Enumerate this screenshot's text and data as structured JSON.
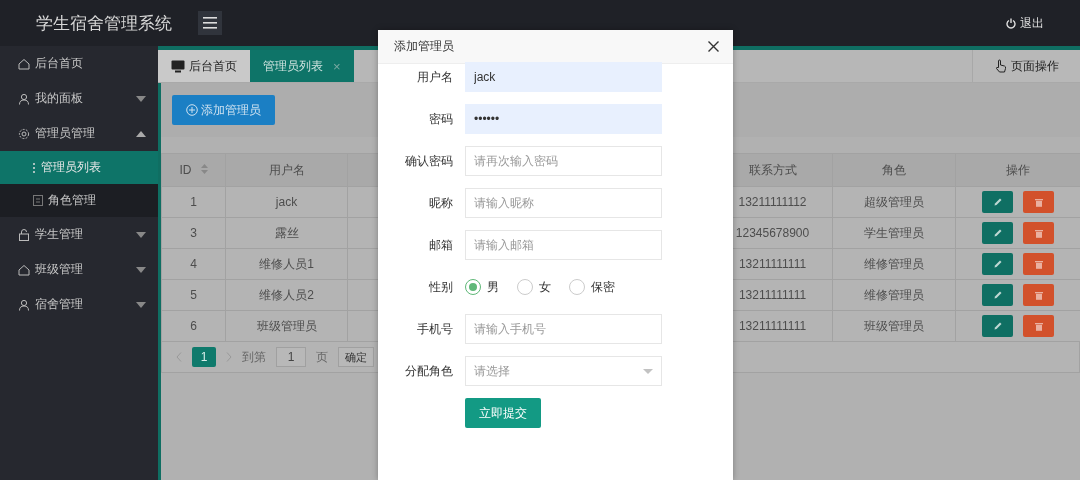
{
  "header": {
    "title": "学生宿舍管理系统",
    "logout": "退出"
  },
  "sidebar": {
    "items": [
      {
        "kind": "link",
        "label": "后台首页",
        "selected": false
      },
      {
        "kind": "group",
        "label": "我的面板",
        "selected": false,
        "expanded": false
      },
      {
        "kind": "group",
        "label": "管理员管理",
        "selected": false,
        "expanded": true,
        "children": [
          {
            "label": "管理员列表",
            "selected": true
          },
          {
            "label": "角色管理",
            "selected": false
          }
        ]
      },
      {
        "kind": "group",
        "label": "学生管理",
        "selected": false,
        "expanded": false
      },
      {
        "kind": "group",
        "label": "班级管理",
        "selected": false,
        "expanded": false
      },
      {
        "kind": "group",
        "label": "宿舍管理",
        "selected": false,
        "expanded": false
      }
    ]
  },
  "tabs": [
    {
      "kind": "home",
      "label": "后台首页",
      "selected": false
    },
    {
      "kind": "page",
      "label": "管理员列表",
      "selected": true,
      "close": "×"
    }
  ],
  "page_actions": "页面操作",
  "add_button": "添加管理员",
  "table": {
    "columns": [
      {
        "label": "ID",
        "sortable": true
      },
      {
        "label": "用户名",
        "sortable": false
      },
      {
        "label": "联系方式",
        "sortable": false
      },
      {
        "label": "角色",
        "sortable": false
      },
      {
        "label": "操作",
        "sortable": false
      }
    ],
    "rows": [
      {
        "id": "1",
        "username": "jack",
        "contact": "13211111112",
        "role": "超级管理员"
      },
      {
        "id": "3",
        "username": "露丝",
        "contact": "12345678900",
        "role": "学生管理员"
      },
      {
        "id": "4",
        "username": "维修人员1",
        "contact": "13211111111",
        "role": "维修管理员"
      },
      {
        "id": "5",
        "username": "维修人员2",
        "contact": "13211111111",
        "role": "维修管理员"
      },
      {
        "id": "6",
        "username": "班级管理员",
        "contact": "13211111111",
        "role": "班级管理员"
      }
    ]
  },
  "pagination": {
    "current": "1",
    "goto_label": "到第",
    "page_value": "1",
    "page_unit": "页",
    "confirm": "确定"
  },
  "modal": {
    "title": "添加管理员",
    "fields": [
      {
        "kind": "input",
        "label": "用户名",
        "value": "jack",
        "autofilled": true
      },
      {
        "kind": "input",
        "label": "密码",
        "value": "••••••",
        "autofilled": true
      },
      {
        "kind": "input",
        "label": "确认密码",
        "placeholder": "请再次输入密码",
        "autofilled": false
      },
      {
        "kind": "input",
        "label": "昵称",
        "placeholder": "请输入昵称",
        "autofilled": false
      },
      {
        "kind": "input",
        "label": "邮箱",
        "placeholder": "请输入邮箱",
        "autofilled": false
      },
      {
        "kind": "radio",
        "label": "性别",
        "options": [
          {
            "label": "男",
            "selected": true
          },
          {
            "label": "女",
            "selected": false
          },
          {
            "label": "保密",
            "selected": false
          }
        ]
      },
      {
        "kind": "input",
        "label": "手机号",
        "placeholder": "请输入手机号",
        "autofilled": false
      },
      {
        "kind": "select",
        "label": "分配角色",
        "placeholder": "请选择"
      }
    ],
    "submit": "立即提交"
  }
}
